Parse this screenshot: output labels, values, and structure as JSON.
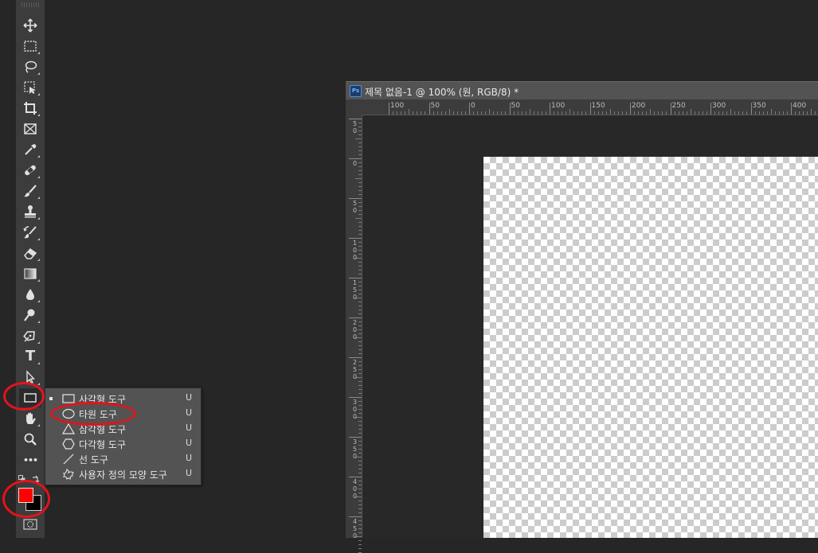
{
  "document": {
    "app_badge": "Ps",
    "title": "제목 없음-1 @ 100% (원, RGB/8) *"
  },
  "rulers": {
    "horizontal": [
      "100",
      "50",
      "0",
      "50",
      "100",
      "150",
      "200",
      "250",
      "300",
      "350",
      "400"
    ],
    "vertical": [
      "50",
      "0",
      "50",
      "100",
      "150",
      "200",
      "250",
      "300",
      "350",
      "400",
      "450"
    ]
  },
  "toolbar": {
    "tools": [
      "move-tool",
      "marquee-tool",
      "lasso-tool",
      "object-select-tool",
      "crop-tool",
      "frame-tool",
      "eyedropper-tool",
      "healing-brush-tool",
      "brush-tool",
      "clone-stamp-tool",
      "history-brush-tool",
      "eraser-tool",
      "gradient-tool",
      "blur-tool",
      "dodge-tool",
      "pen-tool",
      "type-tool",
      "path-select-tool",
      "rectangle-tool",
      "hand-tool",
      "zoom-tool",
      "more-tools"
    ],
    "type_glyph": "T",
    "more_glyph": "•••",
    "foreground_color": "#ff0000",
    "background_color": "#000000"
  },
  "flyout": {
    "items": [
      {
        "label": "사각형 도구",
        "key": "U",
        "icon": "rectangle-icon",
        "selected": true
      },
      {
        "label": "타원 도구",
        "key": "U",
        "icon": "ellipse-icon",
        "selected": false
      },
      {
        "label": "삼각형 도구",
        "key": "U",
        "icon": "triangle-icon",
        "selected": false
      },
      {
        "label": "다각형 도구",
        "key": "U",
        "icon": "polygon-icon",
        "selected": false
      },
      {
        "label": "선 도구",
        "key": "U",
        "icon": "line-icon",
        "selected": false
      },
      {
        "label": "사용자 정의 모양 도구",
        "key": "U",
        "icon": "custom-shape-icon",
        "selected": false
      }
    ]
  },
  "annotations": {
    "color": "#e3131c"
  }
}
